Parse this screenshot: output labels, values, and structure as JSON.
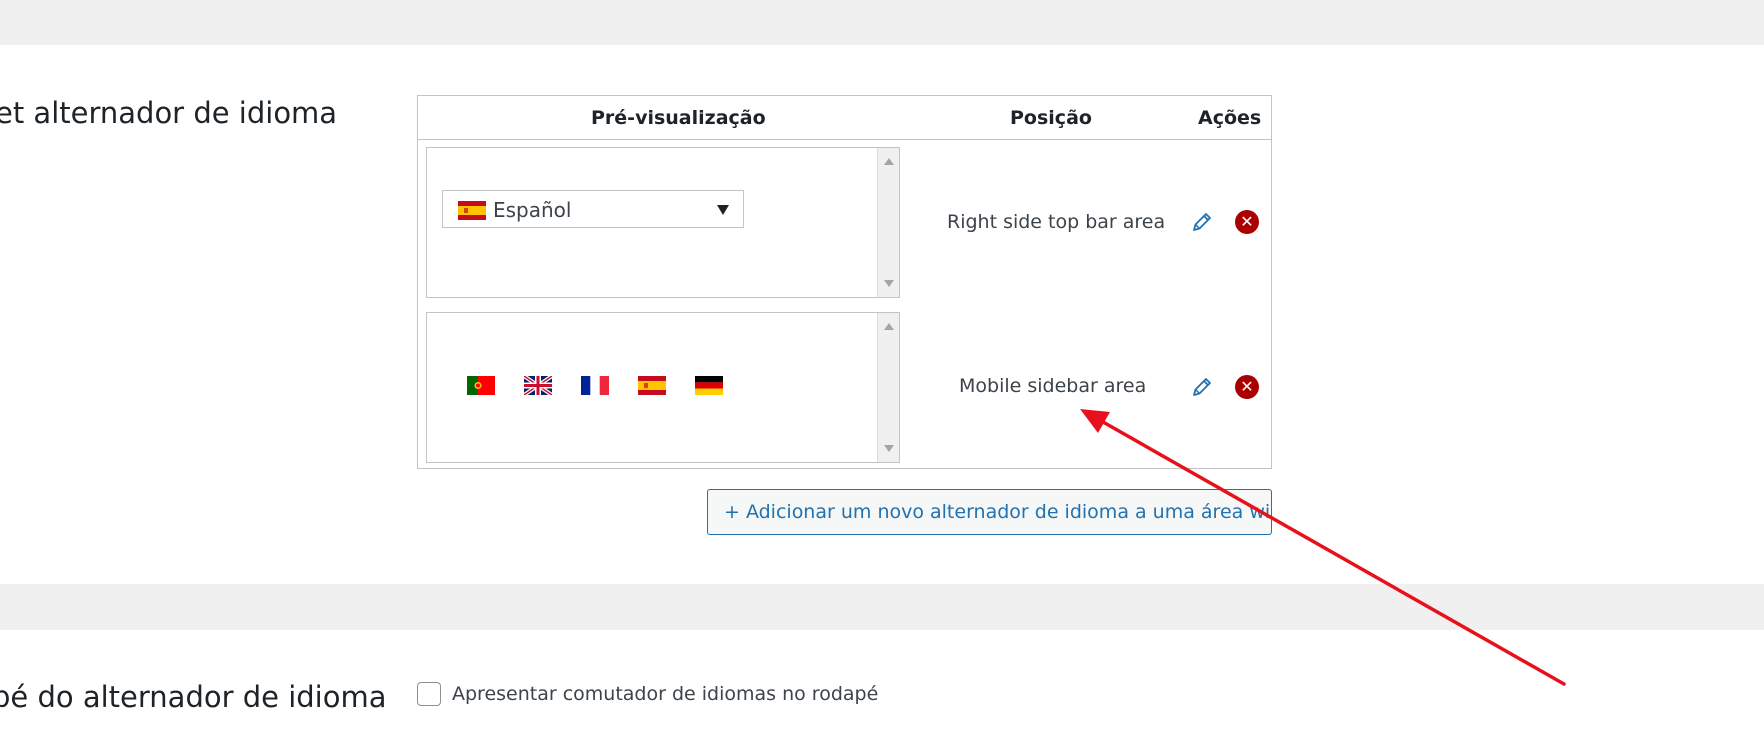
{
  "sections": {
    "top_row_label": "et alternador de idioma",
    "bottom_row_label": "pé do alternador de idioma"
  },
  "table": {
    "headers": {
      "preview": "Pré-visualização",
      "position": "Posição",
      "actions": "Ações"
    },
    "rows": [
      {
        "preview_type": "dropdown",
        "dropdown_value": "Español",
        "dropdown_flag": "flag-es",
        "position": "Right side top bar area"
      },
      {
        "preview_type": "flags",
        "flags": [
          "flag-pt",
          "flag-gb",
          "flag-fr",
          "flag-es",
          "flag-de"
        ],
        "position": "Mobile sidebar area"
      }
    ]
  },
  "add_button_label": "+ Adicionar um novo alternador de idioma a uma área widget",
  "footer_option": {
    "checked": false,
    "label": "Apresentar comutador de idiomas no rodapé"
  },
  "colors": {
    "accent": "#2271b1",
    "delete": "#aa0000",
    "annotation_arrow": "#e8111b",
    "band": "#f0f0f1"
  },
  "icons": {
    "edit": "pencil-icon",
    "delete": "delete-x-icon"
  }
}
